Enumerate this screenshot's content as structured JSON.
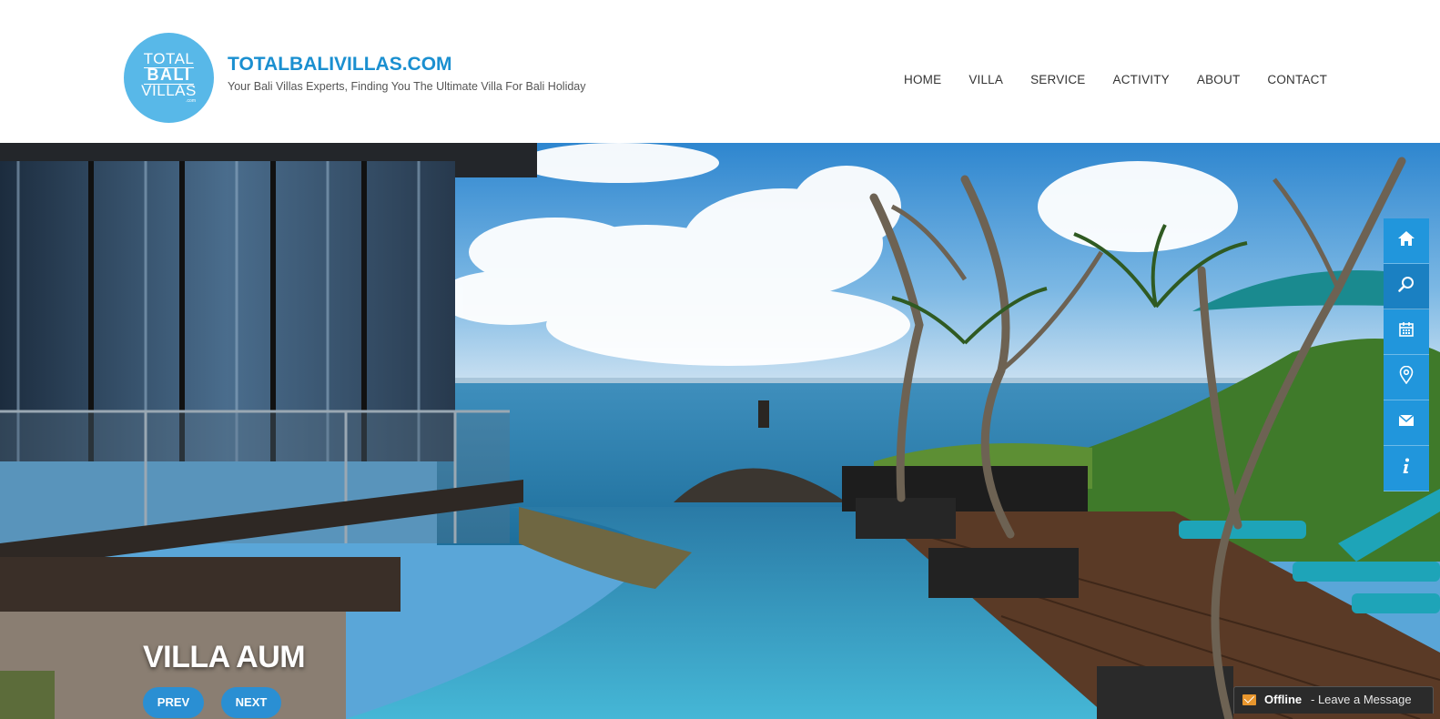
{
  "header": {
    "logo": {
      "line1": "TOTAL",
      "line2": "BALI",
      "line3": "VILLAS",
      "line4": ".com"
    },
    "site_title": "TOTALBALIVILLAS.COM",
    "tagline": "Your Bali Villas Experts, Finding You The Ultimate Villa For Bali Holiday"
  },
  "nav": {
    "items": [
      {
        "label": "HOME"
      },
      {
        "label": "VILLA"
      },
      {
        "label": "SERVICE"
      },
      {
        "label": "ACTIVITY"
      },
      {
        "label": "ABOUT"
      },
      {
        "label": "CONTACT"
      }
    ]
  },
  "slider": {
    "title": "VILLA AUM",
    "prev_label": "PREV",
    "next_label": "NEXT"
  },
  "side_toolbar": {
    "icons": [
      "home-icon",
      "search-icon",
      "calendar-icon",
      "map-pin-icon",
      "mail-icon",
      "info-icon"
    ]
  },
  "chat": {
    "status": "Offline",
    "message": "- Leave a Message"
  },
  "colors": {
    "accent": "#2196dc",
    "title_blue": "#1a8fd0",
    "logo_blue": "#58b8e8"
  }
}
